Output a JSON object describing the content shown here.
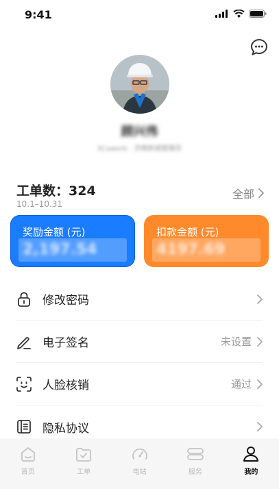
{
  "status_bar": {
    "time": "9:41"
  },
  "profile": {
    "name": "顾兴伟",
    "subtitle": "XCawerb · 济南新城管理员"
  },
  "orders": {
    "label": "工单数：324",
    "date_range": "10.1–10.31",
    "all_link": "全部"
  },
  "cards": {
    "reward": {
      "title": "奖励金额 (元)",
      "value": "2,197.54",
      "color": "#1a7cff"
    },
    "deduction": {
      "title": "扣款金额 (元)",
      "value": "4197.69",
      "color": "#ff8a2c"
    }
  },
  "menu": {
    "items": [
      {
        "label": "修改密码",
        "value": "",
        "icon": "lock-icon"
      },
      {
        "label": "电子签名",
        "value": "未设置",
        "icon": "pen-icon"
      },
      {
        "label": "人脸核销",
        "value": "通过",
        "icon": "face-scan-icon"
      },
      {
        "label": "隐私协议",
        "value": "",
        "icon": "document-icon"
      }
    ]
  },
  "tabbar": {
    "items": [
      {
        "label": "首页",
        "icon": "home-icon",
        "active": false
      },
      {
        "label": "工单",
        "icon": "clipboard-icon",
        "active": false
      },
      {
        "label": "电站",
        "icon": "gauge-icon",
        "active": false
      },
      {
        "label": "服务",
        "icon": "service-icon",
        "active": false
      },
      {
        "label": "我的",
        "icon": "person-icon",
        "active": true
      }
    ]
  }
}
